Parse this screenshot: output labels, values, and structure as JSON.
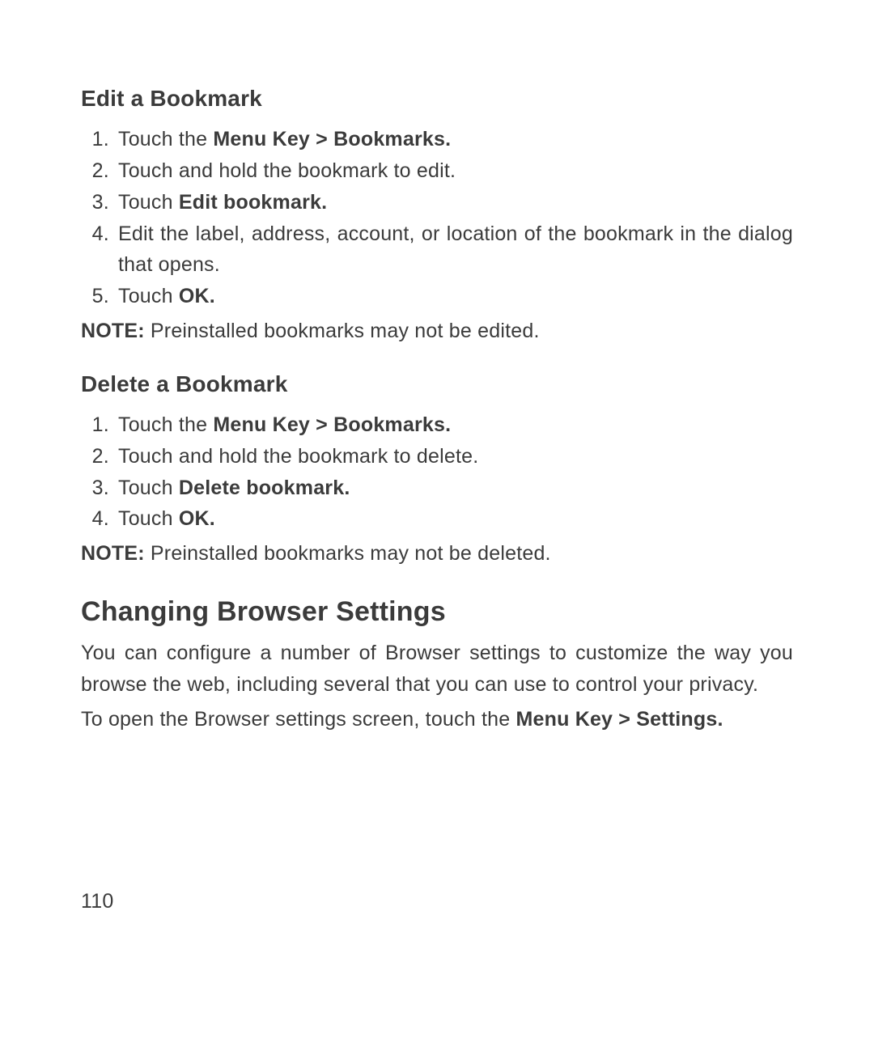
{
  "edit_section": {
    "heading": "Edit a Bookmark",
    "step1_prefix": "Touch the ",
    "step1_bold": "Menu Key > Bookmarks.",
    "step2": "Touch and hold the bookmark to edit.",
    "step3_prefix": "Touch ",
    "step3_bold": "Edit bookmark.",
    "step4": "Edit the label, address, account, or location of the bookmark in the dialog that opens.",
    "step5_prefix": "Touch ",
    "step5_bold": "OK.",
    "note_label": "NOTE:",
    "note_text": " Preinstalled bookmarks may not be edited."
  },
  "delete_section": {
    "heading": "Delete a Bookmark",
    "step1_prefix": "Touch the ",
    "step1_bold": "Menu Key > Bookmarks.",
    "step2": "Touch and hold the bookmark to delete.",
    "step3_prefix": "Touch ",
    "step3_bold": "Delete bookmark.",
    "step4_prefix": "Touch ",
    "step4_bold": "OK.",
    "note_label": "NOTE:",
    "note_text": " Preinstalled bookmarks may not be deleted."
  },
  "settings_section": {
    "heading": "Changing Browser Settings",
    "para1": "You can configure a number of Browser settings to customize the way you browse the web, including several that you can use to control your privacy.",
    "para2_prefix": "To open the Browser settings screen, touch the ",
    "para2_bold": "Menu Key > Settings."
  },
  "page_number": "110"
}
